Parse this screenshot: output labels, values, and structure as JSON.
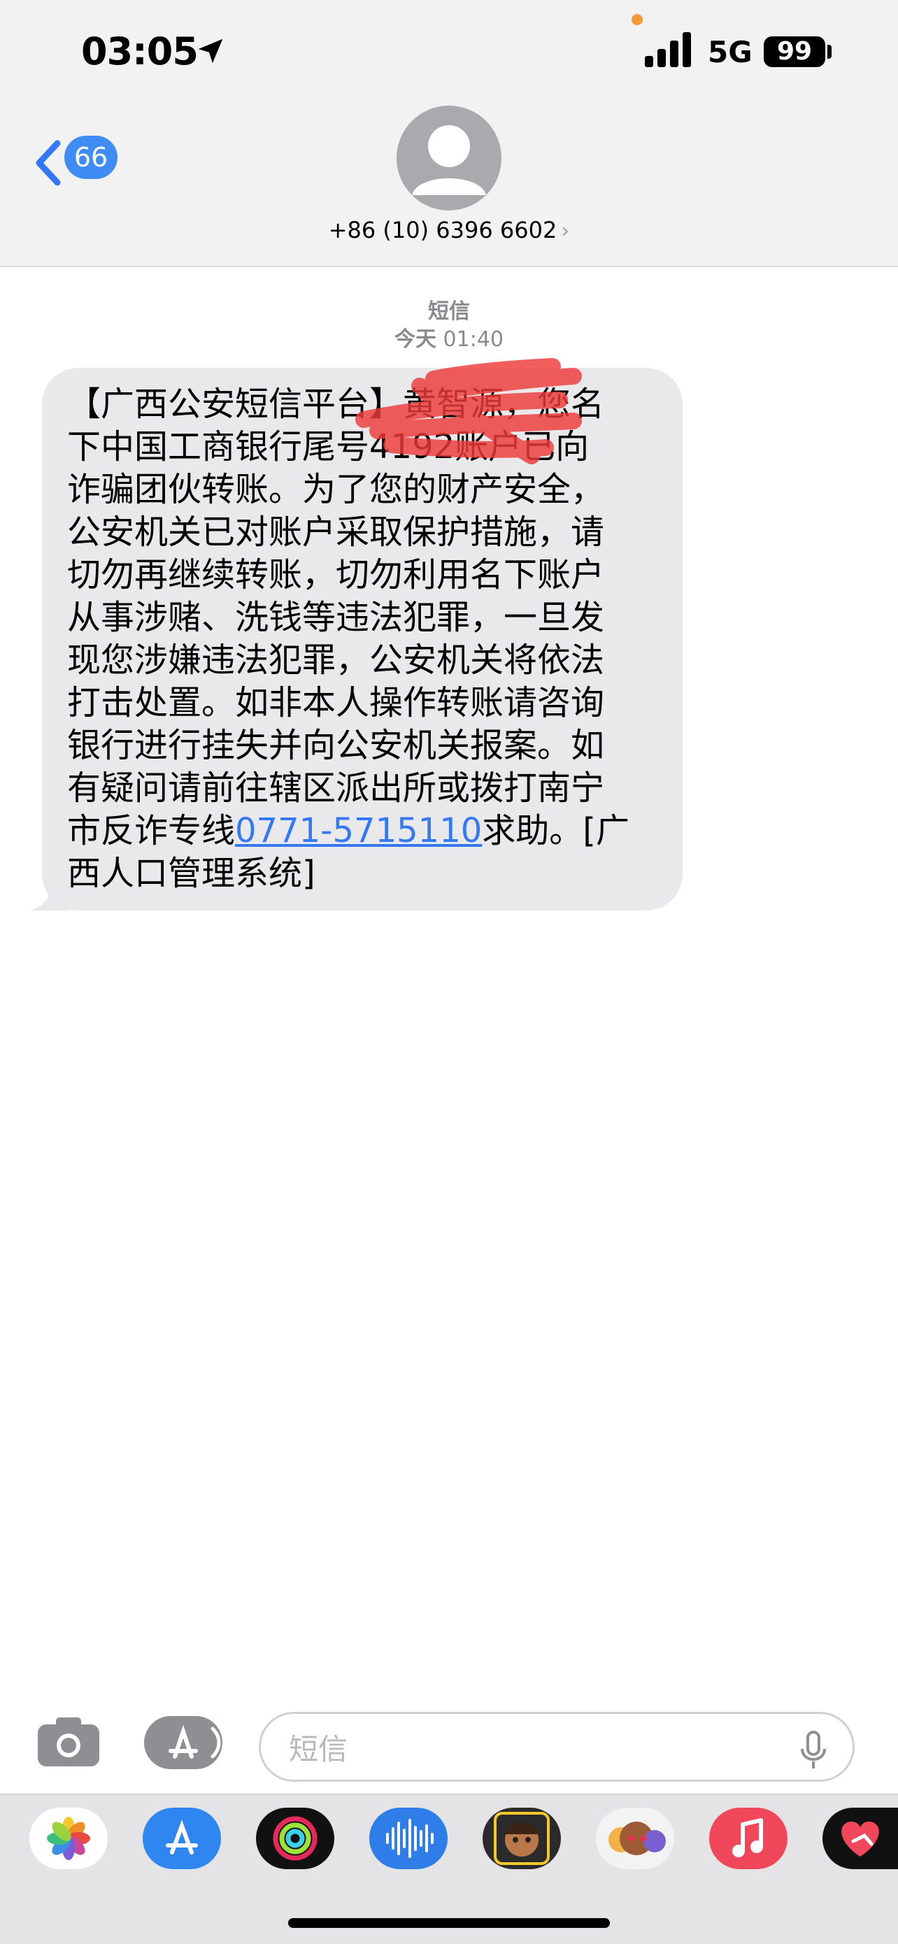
{
  "status": {
    "time": "03:05",
    "network": "5G",
    "battery": "99"
  },
  "header": {
    "back_count": "66",
    "contact": "+86 (10) 6396 6602",
    "contact_chevron": "›"
  },
  "thread": {
    "service": "短信",
    "date_label": "今天",
    "time": "01:40"
  },
  "message": {
    "lines": [
      "【广西公安短信平台】黄智源，您名",
      "下中国工商银行尾号4192账户已向",
      "诈骗团伙转账。为了您的财产安全，",
      "公安机关已对账户采取保护措施，请",
      "切勿再继续转账，切勿利用名下账户",
      "从事涉赌、洗钱等违法犯罪，一旦发",
      "现您涉嫌违法犯罪，公安机关将依法",
      "打击处置。如非本人操作转账请咨询",
      "银行进行挂失并向公安机关报案。如",
      "有疑问请前往辖区派出所或拨打南宁"
    ],
    "line11_prefix": "市反诈专线",
    "phone_link": "0771-5715110",
    "line11_suffix": "求助。[广",
    "line12": "西人口管理系统]"
  },
  "compose": {
    "placeholder": "短信"
  },
  "app_drawer": {
    "apps": [
      "photos-icon",
      "app-store-icon",
      "fitness-icon",
      "voice-memo-icon",
      "memoji-icon",
      "animoji-icon",
      "music-icon",
      "digital-touch-icon"
    ]
  },
  "colors": {
    "accent": "#3478f6",
    "bubble": "#e9e9eb",
    "badge": "#3f8cf5",
    "redaction": "#ee3b3b"
  }
}
